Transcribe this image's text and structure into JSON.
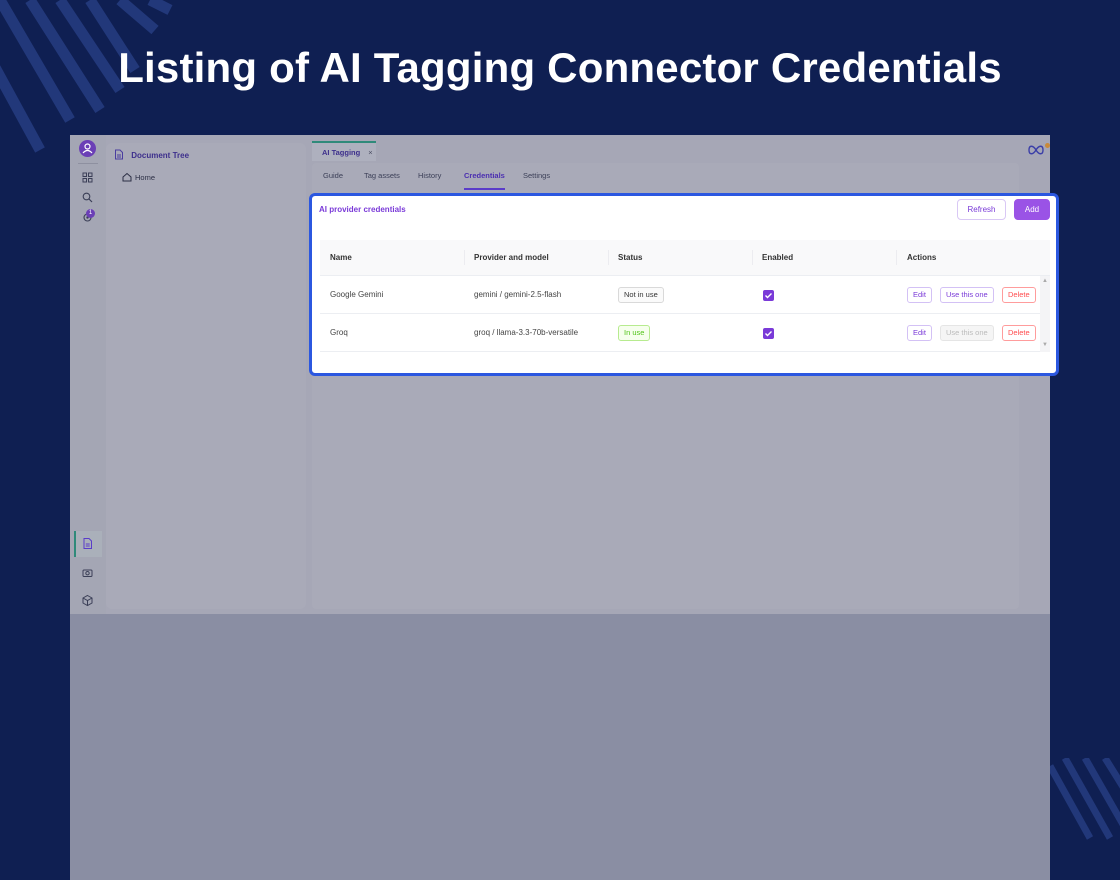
{
  "banner": {
    "title": "Listing of AI Tagging Connector Credentials"
  },
  "rail": {
    "notification_count": "1"
  },
  "tree": {
    "title": "Document Tree",
    "home": "Home"
  },
  "tab": {
    "label": "AI Tagging",
    "close": "×"
  },
  "subtabs": [
    "Guide",
    "Tag assets",
    "History",
    "Credentials",
    "Settings"
  ],
  "active_subtab": "Credentials",
  "card": {
    "title": "AI provider credentials",
    "refresh_label": "Refresh",
    "add_label": "Add"
  },
  "table": {
    "columns": [
      "Name",
      "Provider and model",
      "Status",
      "Enabled",
      "Actions"
    ],
    "rows": [
      {
        "name": "Google Gemini",
        "provider": "gemini / gemini-2.5-flash",
        "status": "Not in use",
        "enabled": true,
        "edit": "Edit",
        "use": "Use this one",
        "delete": "Delete"
      },
      {
        "name": "Groq",
        "provider": "groq / llama-3.3-70b-versatile",
        "status": "In use",
        "enabled": true,
        "edit": "Edit",
        "use": "Use this one",
        "delete": "Delete"
      }
    ]
  },
  "colors": {
    "background": "#0f1f52",
    "accent": "#7a3ad8",
    "highlight_border": "#2b57e0"
  }
}
